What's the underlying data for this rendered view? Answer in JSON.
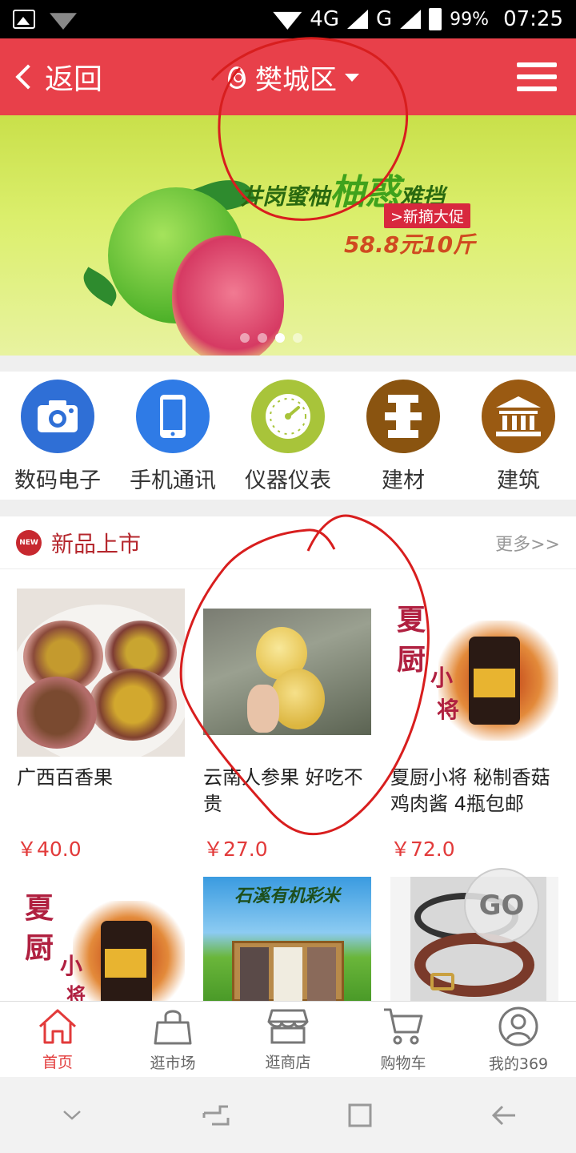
{
  "status_bar": {
    "network": "4G",
    "carrier_g": "G",
    "battery": "99%",
    "time": "07:25"
  },
  "header": {
    "back_label": "返回",
    "location": "樊城区"
  },
  "banner": {
    "slogan_prefix": "井岗蜜柚",
    "slogan_highlight": "柚惑",
    "slogan_suffix": "难挡",
    "tag": ">新摘大促",
    "price": "58.8元10斤",
    "slide_count": 4,
    "active_slide": 3
  },
  "categories": [
    {
      "label": "数码电子",
      "color": "#2f6fd6",
      "icon": "camera-icon"
    },
    {
      "label": "手机通讯",
      "color": "#2f7be6",
      "icon": "phone-icon"
    },
    {
      "label": "仪器仪表",
      "color": "#a8c43a",
      "icon": "gauge-icon"
    },
    {
      "label": "建材",
      "color": "#8a5410",
      "icon": "material-icon"
    },
    {
      "label": "建筑",
      "color": "#9a5a12",
      "icon": "building-icon"
    }
  ],
  "new_products": {
    "badge": "NEW",
    "title": "新品上市",
    "more": "更多>>",
    "items": [
      {
        "name": "广西百香果",
        "price": "￥40.0"
      },
      {
        "name": "云南人参果 好吃不贵",
        "price": "￥27.0"
      },
      {
        "name": "夏厨小将 秘制香菇鸡肉酱 4瓶包邮",
        "price": "￥72.0"
      },
      {
        "name": "",
        "price": ""
      },
      {
        "name": "",
        "price": ""
      },
      {
        "name": "",
        "price": ""
      }
    ],
    "image_texts": {
      "brand_char1": "夏",
      "brand_char2": "厨",
      "brand_small": "小",
      "brand_small2": "将",
      "rice_title": "石溪有机彩米"
    }
  },
  "go_button": "GO",
  "tabbar": [
    {
      "label": "首页",
      "icon": "home-icon",
      "active": true
    },
    {
      "label": "逛市场",
      "icon": "bag-icon",
      "active": false
    },
    {
      "label": "逛商店",
      "icon": "store-icon",
      "active": false
    },
    {
      "label": "购物车",
      "icon": "cart-icon",
      "active": false
    },
    {
      "label": "我的369",
      "icon": "user-icon",
      "active": false
    }
  ],
  "colors": {
    "brand_red": "#e8404a",
    "price_red": "#e23a3a",
    "annotation_red": "#d81e1e"
  }
}
